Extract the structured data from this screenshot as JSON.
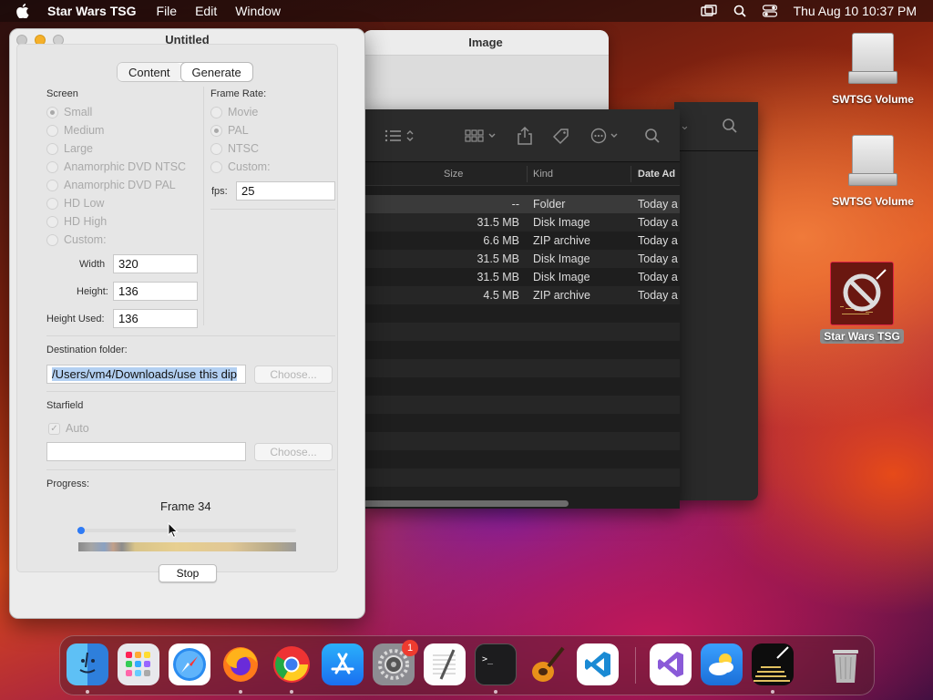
{
  "menubar": {
    "app_name": "Star Wars TSG",
    "items": [
      "File",
      "Edit",
      "Window"
    ],
    "datetime": "Thu Aug 10  10:37 PM"
  },
  "desktop": {
    "icons": [
      {
        "label": "SWTSG Volume"
      },
      {
        "label": "SWTSG Volume"
      },
      {
        "label": "Star Wars TSG"
      }
    ]
  },
  "image_window": {
    "title": "Image"
  },
  "finder": {
    "columns": {
      "size": "Size",
      "kind": "Kind",
      "date": "Date Ad"
    },
    "rows": [
      {
        "size": "--",
        "kind": "Folder",
        "date": "Today a"
      },
      {
        "size": "31.5 MB",
        "kind": "Disk Image",
        "date": "Today a"
      },
      {
        "size": "6.6 MB",
        "kind": "ZIP archive",
        "date": "Today a"
      },
      {
        "size": "31.5 MB",
        "kind": "Disk Image",
        "date": "Today a"
      },
      {
        "size": "31.5 MB",
        "kind": "Disk Image",
        "date": "Today a"
      },
      {
        "size": "4.5 MB",
        "kind": "ZIP archive",
        "date": "Today a"
      }
    ]
  },
  "main_window": {
    "title": "Untitled",
    "tabs": [
      "Content",
      "Generate"
    ],
    "screen": {
      "label": "Screen",
      "options": [
        "Small",
        "Medium",
        "Large",
        "Anamorphic DVD NTSC",
        "Anamorphic DVD PAL",
        "HD Low",
        "HD High",
        "Custom:"
      ],
      "width_label": "Width",
      "width_value": "320",
      "height_label": "Height:",
      "height_value": "136",
      "height_used_label": "Height Used:",
      "height_used_value": "136"
    },
    "frame_rate": {
      "label": "Frame Rate:",
      "options": [
        "Movie",
        "PAL",
        "NTSC",
        "Custom:"
      ],
      "fps_label": "fps:",
      "fps_value": "25"
    },
    "destination": {
      "label": "Destination folder:",
      "value": "/Users/vm4/Downloads/use this dip",
      "choose": "Choose..."
    },
    "starfield": {
      "label": "Starfield",
      "auto_label": "Auto",
      "value": "",
      "choose": "Choose..."
    },
    "progress": {
      "label": "Progress:",
      "status": "Frame 34",
      "stop": "Stop"
    }
  },
  "dock": {
    "badge_count": "1"
  }
}
